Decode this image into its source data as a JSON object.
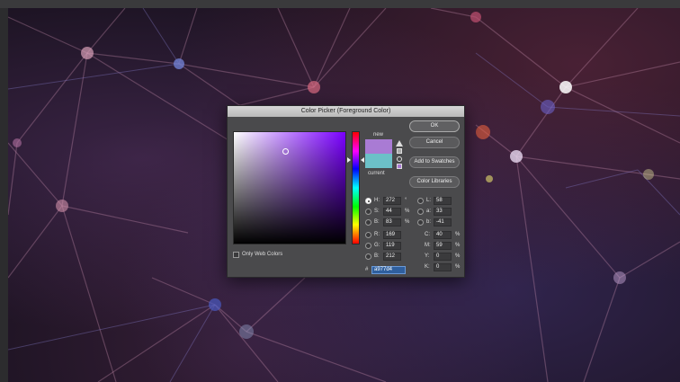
{
  "dialog": {
    "title": "Color Picker (Foreground Color)",
    "new_label": "new",
    "current_label": "current",
    "new_color": "#a97bd4",
    "current_color": "#6cc0c8",
    "buttons": {
      "ok": "OK",
      "cancel": "Cancel",
      "add_to_swatches": "Add to Swatches",
      "color_libraries": "Color Libraries"
    },
    "hsb": [
      {
        "label": "H:",
        "value": "272",
        "unit": "°",
        "selected": true
      },
      {
        "label": "S:",
        "value": "44",
        "unit": "%",
        "selected": false
      },
      {
        "label": "B:",
        "value": "83",
        "unit": "%",
        "selected": false
      }
    ],
    "rgb": [
      {
        "label": "R:",
        "value": "169"
      },
      {
        "label": "G:",
        "value": "119"
      },
      {
        "label": "B:",
        "value": "212"
      }
    ],
    "lab": [
      {
        "label": "L:",
        "value": "58"
      },
      {
        "label": "a:",
        "value": "33"
      },
      {
        "label": "b:",
        "value": "-41"
      }
    ],
    "cmyk": [
      {
        "label": "C:",
        "value": "40",
        "unit": "%"
      },
      {
        "label": "M:",
        "value": "59",
        "unit": "%"
      },
      {
        "label": "Y:",
        "value": "0",
        "unit": "%"
      },
      {
        "label": "K:",
        "value": "0",
        "unit": "%"
      }
    ],
    "hex_prefix": "#",
    "hex_value": "a977d4",
    "only_web_colors": "Only Web Colors",
    "hue_accent": "#7a00ff"
  }
}
